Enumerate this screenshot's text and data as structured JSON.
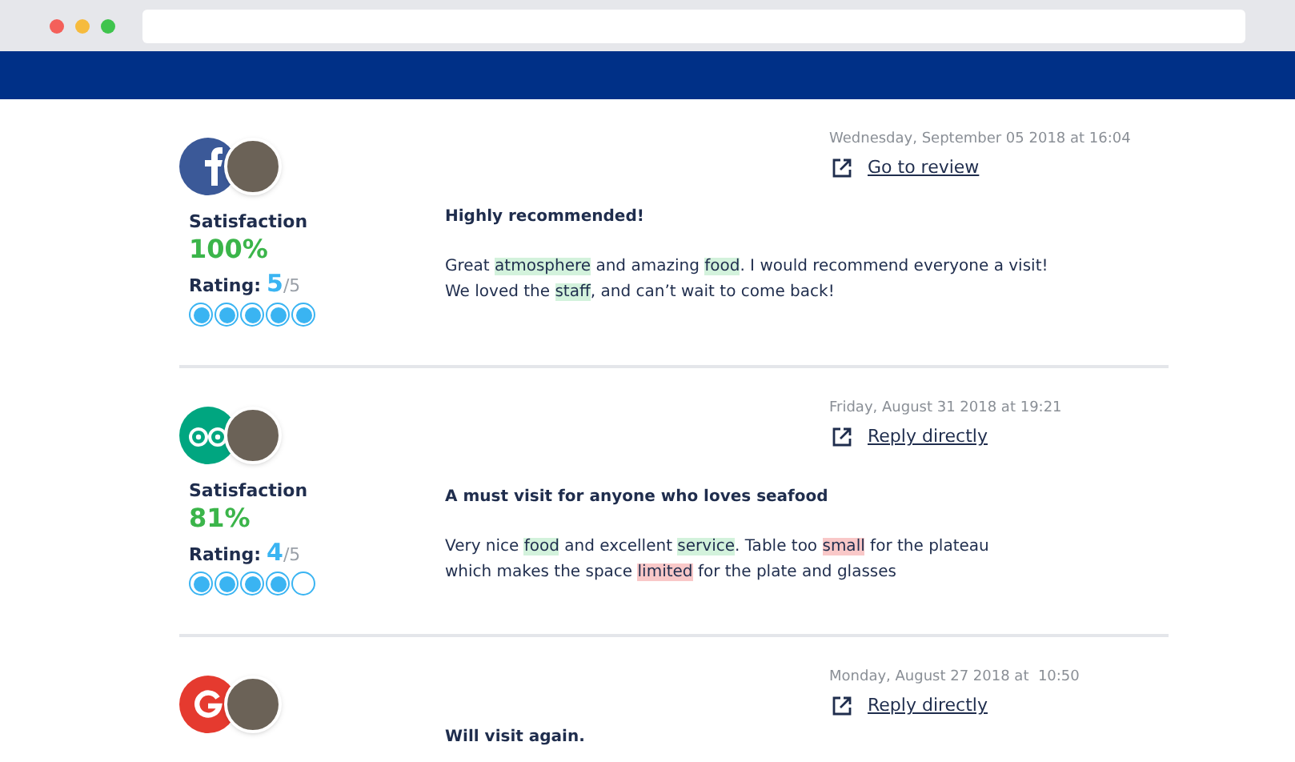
{
  "reviews": [
    {
      "kind": "facebook",
      "date": "Wednesday, September 05 2018 at 16:04",
      "link": "Go to review",
      "satisfaction_label": "Satisfaction",
      "satisfaction": "100%",
      "rating_label": "Rating:",
      "rating_value": "5",
      "rating_max": "/5",
      "stars": 5,
      "title": "Highly recommended!",
      "body": [
        [
          {
            "text": "Great "
          },
          {
            "text": "atmosphere",
            "kind": "positive"
          },
          {
            "text": " and amazing "
          },
          {
            "text": "food",
            "kind": "positive"
          },
          {
            "text": ". I would recommend everyone a visit!"
          }
        ],
        [
          {
            "text": "We loved the "
          },
          {
            "text": "staff",
            "kind": "positive"
          },
          {
            "text": ", and can’t wait to come back!"
          }
        ]
      ]
    },
    {
      "kind": "tripadvisor",
      "date": "Friday, August 31 2018 at 19:21",
      "link": "Reply directly",
      "satisfaction_label": "Satisfaction",
      "satisfaction": "81%",
      "rating_label": "Rating:",
      "rating_value": "4",
      "rating_max": "/5",
      "stars": 4,
      "title": "A must visit for anyone who loves seafood",
      "body": [
        [
          {
            "text": "Very nice "
          },
          {
            "text": "food",
            "kind": "positive"
          },
          {
            "text": " and excellent "
          },
          {
            "text": "service",
            "kind": "positive"
          },
          {
            "text": ". Table too "
          },
          {
            "text": "small",
            "kind": "negative"
          },
          {
            "text": " for the plateau"
          }
        ],
        [
          {
            "text": "which makes the space "
          },
          {
            "text": "limited",
            "kind": "negative"
          },
          {
            "text": " for the plate and glasses"
          }
        ]
      ]
    },
    {
      "kind": "google",
      "date": "Monday, August 27 2018 at  10:50",
      "link": "Reply directly",
      "title": "Will visit again."
    }
  ]
}
